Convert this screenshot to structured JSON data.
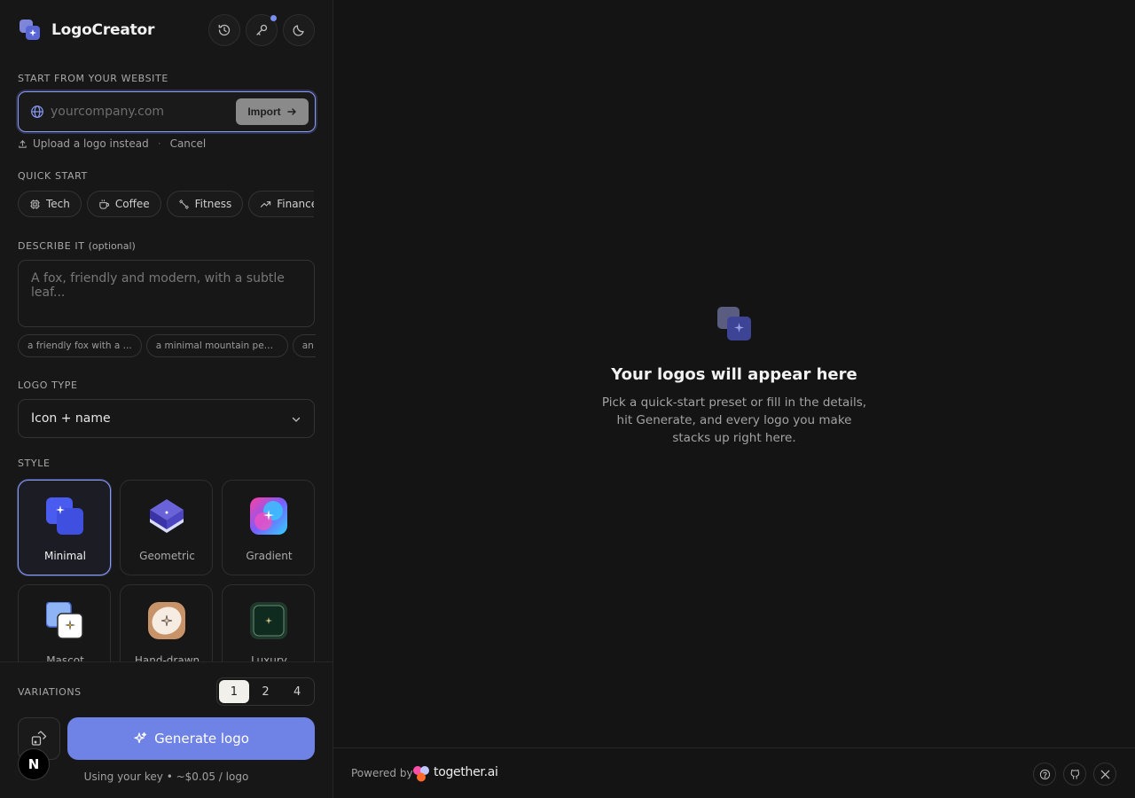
{
  "app": {
    "title": "LogoCreator"
  },
  "website": {
    "label": "START FROM YOUR WEBSITE",
    "placeholder": "yourcompany.com",
    "value": "",
    "import_label": "Import",
    "upload_label": "Upload a logo instead",
    "cancel_label": "Cancel"
  },
  "quick_start": {
    "label": "QUICK START",
    "chips": [
      {
        "label": "Tech",
        "icon": "cpu-icon"
      },
      {
        "label": "Coffee",
        "icon": "coffee-icon"
      },
      {
        "label": "Fitness",
        "icon": "dumbbell-icon"
      },
      {
        "label": "Finance",
        "icon": "trending-up-icon"
      }
    ]
  },
  "describe": {
    "label": "DESCRIBE IT",
    "label_optional": "(optional)",
    "placeholder": "A fox, friendly and modern, with a subtle leaf...",
    "value": "",
    "suggestions": [
      "a friendly fox with a ...",
      "a minimal mountain pea...",
      "an obs"
    ]
  },
  "logo_type": {
    "label": "LOGO TYPE",
    "value": "Icon + name"
  },
  "style": {
    "label": "STYLE",
    "selected": "Minimal",
    "options": [
      {
        "label": "Minimal"
      },
      {
        "label": "Geometric"
      },
      {
        "label": "Gradient"
      },
      {
        "label": "Mascot"
      },
      {
        "label": "Hand-drawn"
      },
      {
        "label": "Luxury"
      }
    ]
  },
  "variations": {
    "label": "VARIATIONS",
    "options": [
      "1",
      "2",
      "4"
    ],
    "selected": "1"
  },
  "generate": {
    "label": "Generate logo",
    "note": "Using your key • ~$0.05 / logo"
  },
  "badge": {
    "letter": "N"
  },
  "empty_state": {
    "title": "Your logos will appear here",
    "subtitle": "Pick a quick-start preset or fill in the details, hit Generate, and every logo you make stacks up right here."
  },
  "footer": {
    "powered_by": "Powered by",
    "brand": "together.ai"
  },
  "colors": {
    "accent": "#6f82e6",
    "accent_border": "#8a9af5",
    "background": "#141414",
    "sidebar": "#171717"
  }
}
